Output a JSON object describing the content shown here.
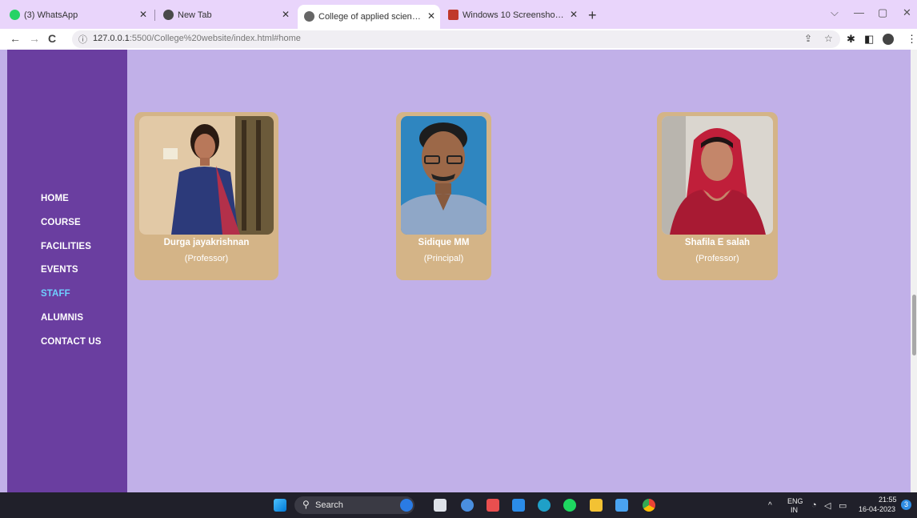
{
  "browser": {
    "tabs": [
      {
        "label": "(3) WhatsApp",
        "active": false
      },
      {
        "label": "New Tab",
        "active": false
      },
      {
        "label": "College of applied science,Kuzha",
        "active": true
      },
      {
        "label": "Windows 10 Screenshots Folder |",
        "active": false
      }
    ],
    "address": {
      "host": "127.0.0.1",
      "path": ":5500/College%20website/index.html#home"
    }
  },
  "sidebar": {
    "items": [
      {
        "label": "HOME",
        "active": false
      },
      {
        "label": "COURSE",
        "active": false
      },
      {
        "label": "FACILITIES",
        "active": false
      },
      {
        "label": "EVENTS",
        "active": false
      },
      {
        "label": "STAFF",
        "active": true
      },
      {
        "label": "ALUMNIS",
        "active": false
      },
      {
        "label": "CONTACT US",
        "active": false
      }
    ]
  },
  "staff": [
    {
      "name": "Durga jayakrishnan",
      "role": "(Professor)"
    },
    {
      "name": "Sidique MM",
      "role": "(Principal)"
    },
    {
      "name": "Shafila E salah",
      "role": "(Professor)"
    }
  ],
  "taskbar": {
    "search_label": "Search",
    "lang_top": "ENG",
    "lang_bottom": "IN",
    "time": "21:55",
    "date": "16-04-2023",
    "notification_count": "3"
  },
  "colors": {
    "page_bg": "#c1b0e8",
    "sidebar_bg": "#6a3ea0",
    "card_bg": "#d4b487",
    "active_menu": "#6fd0ff"
  }
}
